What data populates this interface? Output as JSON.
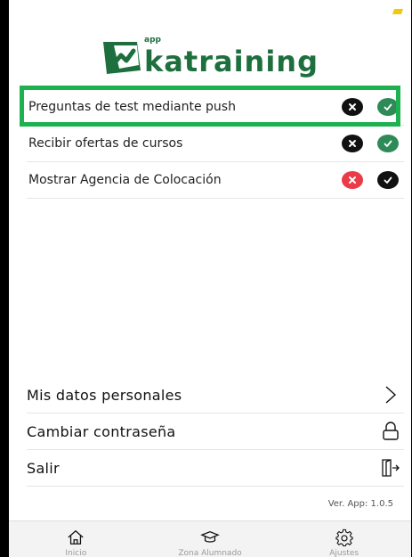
{
  "logo": {
    "small": "app",
    "word": "katraining"
  },
  "settings": [
    {
      "label": "Preguntas de test mediante push",
      "no_color": "black",
      "yes_color": "green"
    },
    {
      "label": "Recibir ofertas de cursos",
      "no_color": "black",
      "yes_color": "green"
    },
    {
      "label": "Mostrar Agencia de Colocación",
      "no_color": "red",
      "yes_color": "black"
    }
  ],
  "menu": [
    {
      "label": "Mis datos personales",
      "icon": "chevron-right-icon"
    },
    {
      "label": "Cambiar contraseña",
      "icon": "lock-icon"
    },
    {
      "label": "Salir",
      "icon": "exit-door-icon"
    }
  ],
  "version": "Ver. App: 1.0.5",
  "tabs": [
    {
      "label": "Inicio",
      "icon": "home-icon"
    },
    {
      "label": "Zona Alumnado",
      "icon": "graduation-cap-icon"
    },
    {
      "label": "Ajustes",
      "icon": "gear-icon"
    }
  ],
  "colors": {
    "brand_green": "#1e6f3e",
    "toggle_green": "#2e8b57",
    "toggle_red": "#ea3b48",
    "highlight": "#1db24f"
  }
}
